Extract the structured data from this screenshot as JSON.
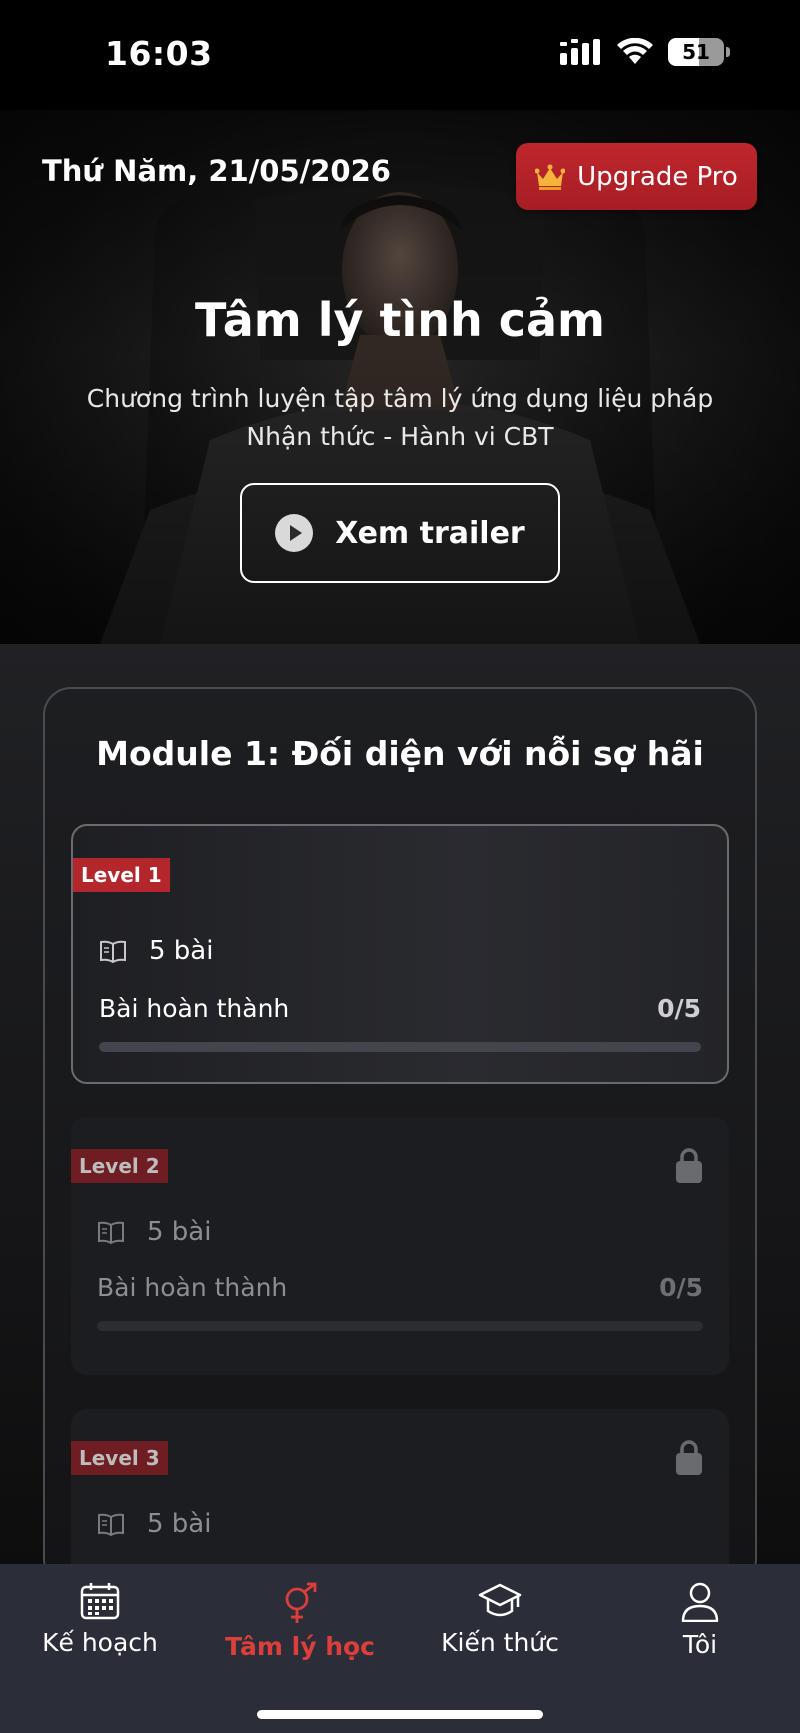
{
  "status": {
    "time": "16:03",
    "battery": "51"
  },
  "hero": {
    "date": "Thứ Năm, 21/05/2026",
    "upgrade_label": "Upgrade Pro",
    "title": "Tâm lý tình cảm",
    "subtitle_line1": "Chương trình luyện tập tâm lý ứng dụng liệu pháp",
    "subtitle_line2": "Nhận thức - Hành vi CBT",
    "trailer_label": "Xem trailer"
  },
  "module": {
    "title": "Module 1: Đối diện với nỗi sợ hãi",
    "levels": [
      {
        "tag": "Level 1",
        "lessons": "5 bài",
        "progress_label": "Bài hoàn thành",
        "progress_count": "0/5",
        "progress": 0,
        "locked": false
      },
      {
        "tag": "Level 2",
        "lessons": "5 bài",
        "progress_label": "Bài hoàn thành",
        "progress_count": "0/5",
        "progress": 0,
        "locked": true
      },
      {
        "tag": "Level 3",
        "lessons": "5 bài",
        "locked": true
      }
    ]
  },
  "tabbar": {
    "tabs": [
      {
        "label": "Kế hoạch",
        "icon": "calendar-icon",
        "active": false
      },
      {
        "label": "Tâm lý học",
        "icon": "gender-icon",
        "active": true
      },
      {
        "label": "Kiến thức",
        "icon": "graduation-cap-icon",
        "active": false
      },
      {
        "label": "Tôi",
        "icon": "user-icon",
        "active": false
      }
    ]
  },
  "colors": {
    "accent": "#c0262c",
    "active_tab": "#dc3f3b",
    "tabbar_bg": "#2b2d38"
  }
}
